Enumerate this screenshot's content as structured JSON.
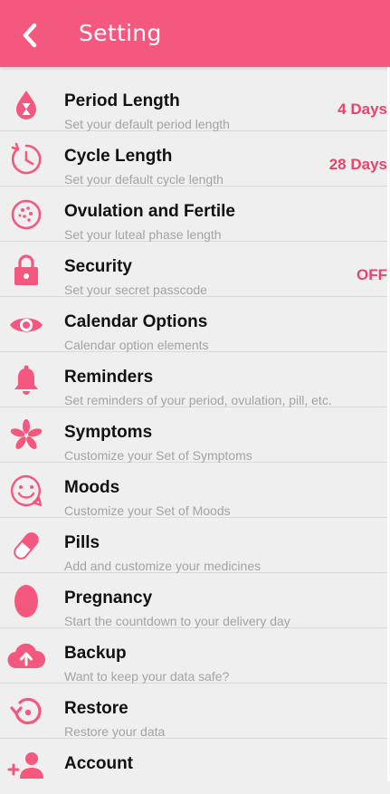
{
  "header": {
    "title": "Setting",
    "back_icon": "chevron-left-icon",
    "color": "#f5587f"
  },
  "accent_color": "#f5587f",
  "value_color": "#e8436d",
  "items": [
    {
      "label": "Period Length",
      "sub": "Set your default period length",
      "value": "4 Days",
      "icon": "drop-hourglass-icon"
    },
    {
      "label": "Cycle Length",
      "sub": "Set your default cycle length",
      "value": "28 Days",
      "icon": "clock-cycle-icon"
    },
    {
      "label": "Ovulation and Fertile",
      "sub": "Set your luteal phase length",
      "value": "",
      "icon": "egg-cell-icon"
    },
    {
      "label": "Security",
      "sub": "Set your secret passcode",
      "value": "OFF",
      "icon": "lock-icon"
    },
    {
      "label": "Calendar Options",
      "sub": "Calendar option elements",
      "value": "",
      "icon": "eye-icon"
    },
    {
      "label": "Reminders",
      "sub": "Set reminders of your period, ovulation, pill, etc.",
      "value": "",
      "icon": "bell-icon"
    },
    {
      "label": "Symptoms",
      "sub": "Customize your Set of Symptoms",
      "value": "",
      "icon": "asterisk-icon"
    },
    {
      "label": "Moods",
      "sub": "Customize your Set of Moods",
      "value": "",
      "icon": "smiley-icon"
    },
    {
      "label": "Pills",
      "sub": "Add and customize your medicines",
      "value": "",
      "icon": "pill-icon"
    },
    {
      "label": "Pregnancy",
      "sub": "Start the countdown to your delivery day",
      "value": "",
      "icon": "oval-icon"
    },
    {
      "label": "Backup",
      "sub": "Want to keep your data safe?",
      "value": "",
      "icon": "cloud-upload-icon"
    },
    {
      "label": "Restore",
      "sub": "Restore your data",
      "value": "",
      "icon": "restore-icon"
    },
    {
      "label": "Account",
      "sub": "",
      "value": "",
      "icon": "add-user-icon"
    }
  ]
}
